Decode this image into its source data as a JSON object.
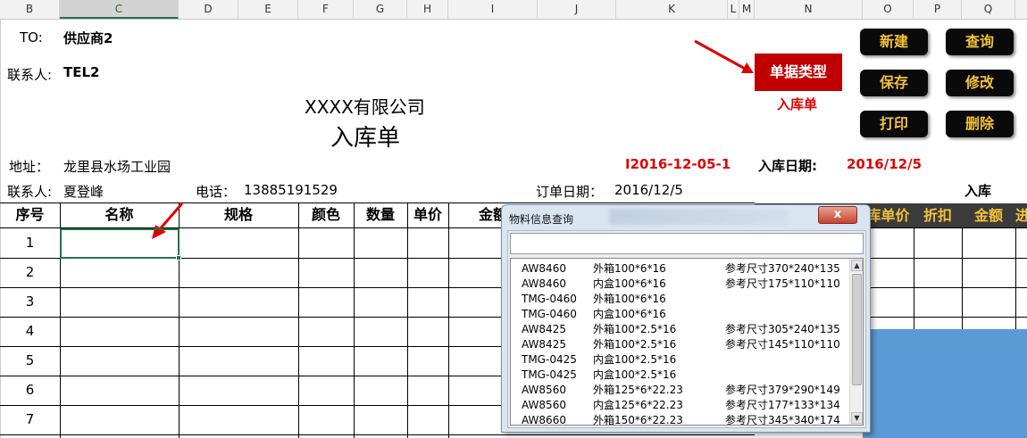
{
  "columns": [
    "B",
    "C",
    "D",
    "E",
    "F",
    "G",
    "H",
    "I",
    "J",
    "K",
    "L",
    "M",
    "N",
    "O",
    "P",
    "Q"
  ],
  "header": {
    "to_label": "TO:",
    "to_value": "供应商2",
    "contact_label": "联系人:",
    "contact_value": "TEL2",
    "company": "XXXX有限公司",
    "doc_title": "入库单"
  },
  "buttons": {
    "new": "新建",
    "query": "查询",
    "save": "保存",
    "modify": "修改",
    "print": "打印",
    "delete": "删除",
    "doc_type": "单据类型",
    "doc_type_value": "入库单"
  },
  "info": {
    "address_label": "地址：",
    "address_value": "龙里县水场工业园",
    "doc_number": "I2016-12-05-1",
    "date_label": "入库日期:",
    "date_value": "2016/12/5",
    "contact_label": "联系人:",
    "contact_value": "夏登峰",
    "phone_label": "电话：",
    "phone_value": "13885191529",
    "order_date_label": "订单日期：",
    "order_date_value": "2016/12/5",
    "right_header": "入库"
  },
  "table": {
    "headers": [
      "序号",
      "名称",
      "规格",
      "颜色",
      "数量",
      "单价",
      "金额"
    ],
    "right_headers": [
      "库单价",
      "折扣",
      "金额",
      "进"
    ],
    "row_numbers": [
      "1",
      "2",
      "3",
      "4",
      "5",
      "6",
      "7"
    ]
  },
  "dialog": {
    "title": "物料信息查询",
    "close_glyph": "x",
    "search_value": "",
    "items": [
      {
        "code": "AW8460",
        "spec": "外箱100*6*16",
        "size": "参考尺寸370*240*135"
      },
      {
        "code": "AW8460",
        "spec": "内盒100*6*16",
        "size": "参考尺寸175*110*110"
      },
      {
        "code": "TMG-0460",
        "spec": "外箱100*6*16",
        "size": ""
      },
      {
        "code": "TMG-0460",
        "spec": "内盒100*6*16",
        "size": ""
      },
      {
        "code": "AW8425",
        "spec": "外箱100*2.5*16",
        "size": "参考尺寸305*240*135"
      },
      {
        "code": "AW8425",
        "spec": "外箱100*2.5*16",
        "size": "参考尺寸145*110*110"
      },
      {
        "code": "TMG-0425",
        "spec": "内盒100*2.5*16",
        "size": ""
      },
      {
        "code": "TMG-0425",
        "spec": "内盒100*2.5*16",
        "size": ""
      },
      {
        "code": "AW8560",
        "spec": "外箱125*6*22.23",
        "size": "参考尺寸379*290*149"
      },
      {
        "code": "AW8560",
        "spec": "内盒125*6*22.23",
        "size": "参考尺寸177*133*134"
      },
      {
        "code": "AW8660",
        "spec": "外箱150*6*22.23",
        "size": "参考尺寸345*340*174"
      }
    ]
  },
  "colors": {
    "button_bg": "#0a0a0a",
    "button_text": "#f3c23a",
    "doc_type_bg": "#c00000",
    "accent_red": "#e00000",
    "blue_block": "#5b9bd5"
  }
}
